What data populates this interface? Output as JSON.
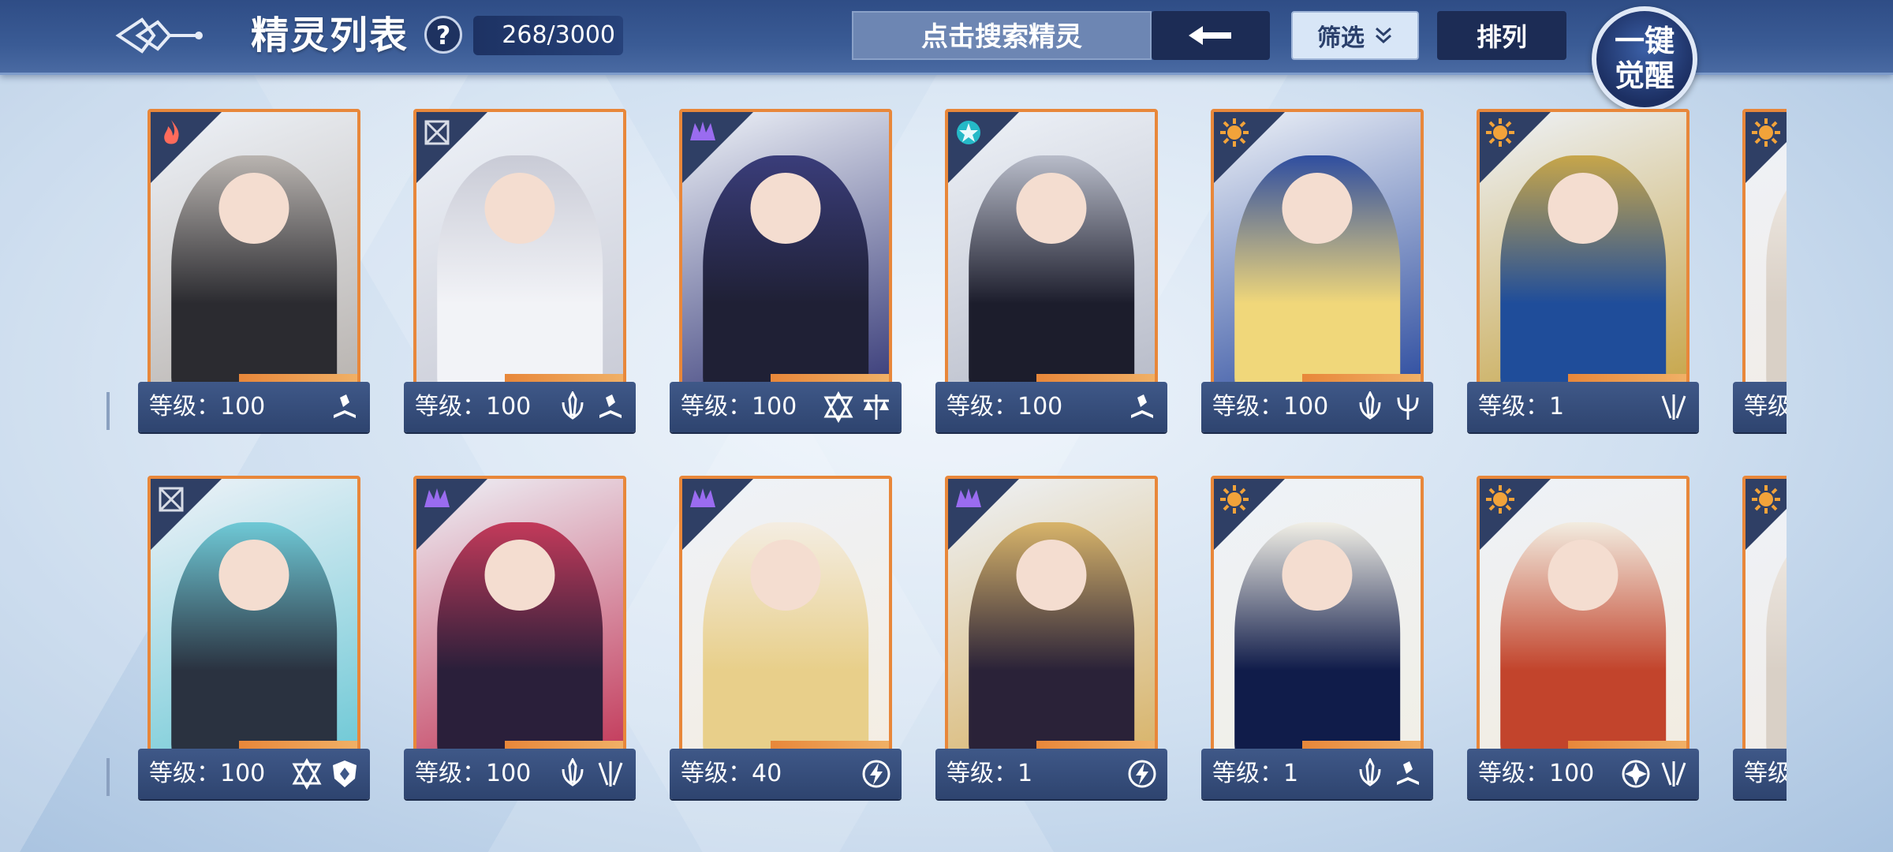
{
  "header": {
    "title": "精灵列表",
    "help": "?",
    "count": "268/3000",
    "search_placeholder": "点击搜索精灵",
    "filter_label": "筛选",
    "sort_label": "排列",
    "awaken_line1": "一键",
    "awaken_line2": "觉醒"
  },
  "level_prefix": "等级：",
  "cards": [
    {
      "level": "等级：100",
      "element": "fire-icon",
      "roles": [
        "book-icon"
      ],
      "palette": [
        "#2b2b30",
        "#b9b4b0"
      ]
    },
    {
      "level": "等级：100",
      "element": "grey-emblem-icon",
      "roles": [
        "sword-icon",
        "book-icon"
      ],
      "palette": [
        "#f2f3f7",
        "#c9cbd6"
      ]
    },
    {
      "level": "等级：100",
      "element": "purple-emblem-icon",
      "roles": [
        "star-icon",
        "scale-icon"
      ],
      "palette": [
        "#1f2035",
        "#3a3d7a"
      ]
    },
    {
      "level": "等级：100",
      "element": "cyan-emblem-icon",
      "roles": [
        "book-icon"
      ],
      "palette": [
        "#1c1d2c",
        "#b8bcc9"
      ]
    },
    {
      "level": "等级：100",
      "element": "sun-icon",
      "roles": [
        "sword-icon",
        "trident-icon"
      ],
      "palette": [
        "#f0d77a",
        "#2f4ea0"
      ]
    },
    {
      "level": "等级：1",
      "element": "sun-icon",
      "roles": [
        "claw-icon"
      ],
      "palette": [
        "#1f4d9a",
        "#c7a64a"
      ]
    },
    {
      "level": "等级",
      "element": "sun-icon",
      "roles": [],
      "palette": [
        "#d9d0c6",
        "#f2ece6"
      ]
    },
    {
      "level": "等级：100",
      "element": "grey-emblem-icon",
      "roles": [
        "star-icon",
        "shield-icon"
      ],
      "palette": [
        "#2a3240",
        "#6fc9d6"
      ]
    },
    {
      "level": "等级：100",
      "element": "purple-emblem-icon",
      "roles": [
        "sword-icon",
        "claw-icon"
      ],
      "palette": [
        "#2a1f3a",
        "#c33a5a"
      ]
    },
    {
      "level": "等级：40",
      "element": "purple-emblem-icon",
      "roles": [
        "bolt-icon"
      ],
      "palette": [
        "#e8cf8a",
        "#f4ede2"
      ]
    },
    {
      "level": "等级：1",
      "element": "purple-emblem-icon",
      "roles": [
        "bolt-icon"
      ],
      "palette": [
        "#2a2238",
        "#d8b46a"
      ]
    },
    {
      "level": "等级：1",
      "element": "sun-icon",
      "roles": [
        "sword-icon",
        "book-icon"
      ],
      "palette": [
        "#101c4a",
        "#f1efe6"
      ]
    },
    {
      "level": "等级：100",
      "element": "sun-icon",
      "roles": [
        "target-icon",
        "claw-icon"
      ],
      "palette": [
        "#c2442c",
        "#f2ece0"
      ]
    },
    {
      "level": "等级",
      "element": "sun-icon",
      "roles": [],
      "palette": [
        "#d9d0c6",
        "#f2ece6"
      ]
    }
  ]
}
